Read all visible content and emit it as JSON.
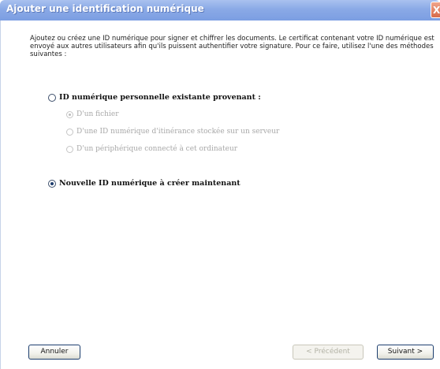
{
  "window": {
    "title": "Ajouter une identification numérique",
    "close_glyph": "X"
  },
  "intro_text": "Ajoutez ou créez une ID numérique pour signer et chiffrer les documents. Le certificat contenant votre ID numérique est envoyé aux autres utilisateurs afin qu'ils puissent authentifier votre signature. Pour ce faire, utilisez l'une des méthodes suivantes :",
  "options": {
    "existing": {
      "label": "ID numérique personnelle existante provenant :",
      "selected": false,
      "enabled": true
    },
    "sub_options": [
      {
        "label": "D'un fichier",
        "selected": true,
        "enabled": false
      },
      {
        "label": "D'une ID numérique d'itinérance stockée sur un serveur",
        "selected": false,
        "enabled": false
      },
      {
        "label": "D'un périphérique connecté à cet ordinateur",
        "selected": false,
        "enabled": false
      }
    ],
    "new": {
      "label": "Nouvelle ID numérique à créer maintenant",
      "selected": true,
      "enabled": true
    }
  },
  "buttons": {
    "cancel": "Annuler",
    "previous": "< Précédent",
    "next": "Suivant >"
  },
  "colors": {
    "titlebar": "#8aa9e6",
    "button_border": "#1c3e6e",
    "disabled_text": "#a8a8a8"
  }
}
